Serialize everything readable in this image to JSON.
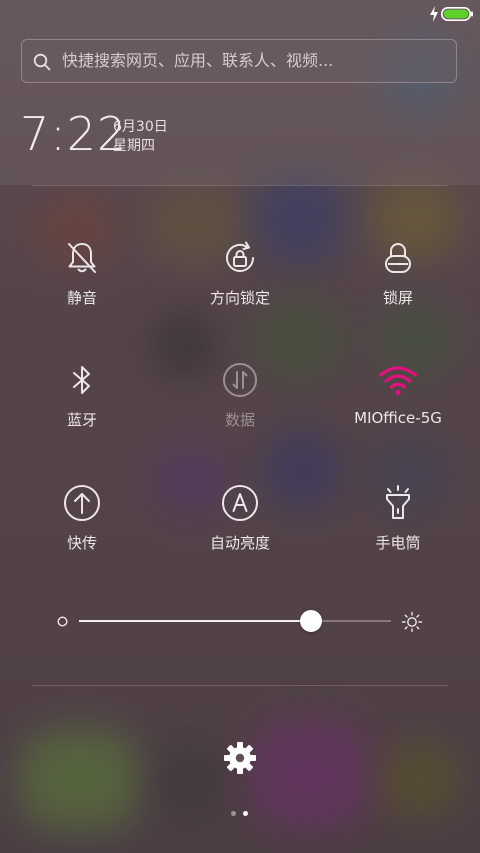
{
  "colors": {
    "accent_wifi": "#e3107d",
    "battery_fill": "#5fd02a",
    "icon_normal": "#ece6e8",
    "icon_disabled": "#9c8f93"
  },
  "status_bar": {
    "charging_icon": "lightning-icon",
    "battery_icon": "battery-full-icon"
  },
  "search": {
    "icon": "search-icon",
    "placeholder": "快捷搜索网页、应用、联系人、视频..."
  },
  "clock": {
    "time": "7:22",
    "date": "6月30日",
    "weekday": "星期四"
  },
  "toggles": [
    {
      "id": "silent",
      "label": "静音",
      "icon": "bell-off-icon",
      "enabled": false
    },
    {
      "id": "rotation-lock",
      "label": "方向锁定",
      "icon": "rotation-lock-icon",
      "enabled": false
    },
    {
      "id": "lock-screen",
      "label": "锁屏",
      "icon": "lock-icon",
      "enabled": false
    },
    {
      "id": "bluetooth",
      "label": "蓝牙",
      "icon": "bluetooth-icon",
      "enabled": false
    },
    {
      "id": "mobile-data",
      "label": "数据",
      "icon": "mobile-data-icon",
      "enabled": false,
      "disabled": true
    },
    {
      "id": "wifi",
      "label": "MIOffice-5G",
      "icon": "wifi-icon",
      "enabled": true
    },
    {
      "id": "quick-share",
      "label": "快传",
      "icon": "upload-circle-icon",
      "enabled": false
    },
    {
      "id": "auto-brightness",
      "label": "自动亮度",
      "icon": "auto-brightness-icon",
      "enabled": false
    },
    {
      "id": "flashlight",
      "label": "手电筒",
      "icon": "flashlight-icon",
      "enabled": false
    }
  ],
  "brightness": {
    "level": 0.745,
    "min_icon": "brightness-low-icon",
    "max_icon": "brightness-high-icon"
  },
  "settings": {
    "icon": "gear-icon"
  },
  "pager": {
    "pages": 2,
    "current": 2
  }
}
